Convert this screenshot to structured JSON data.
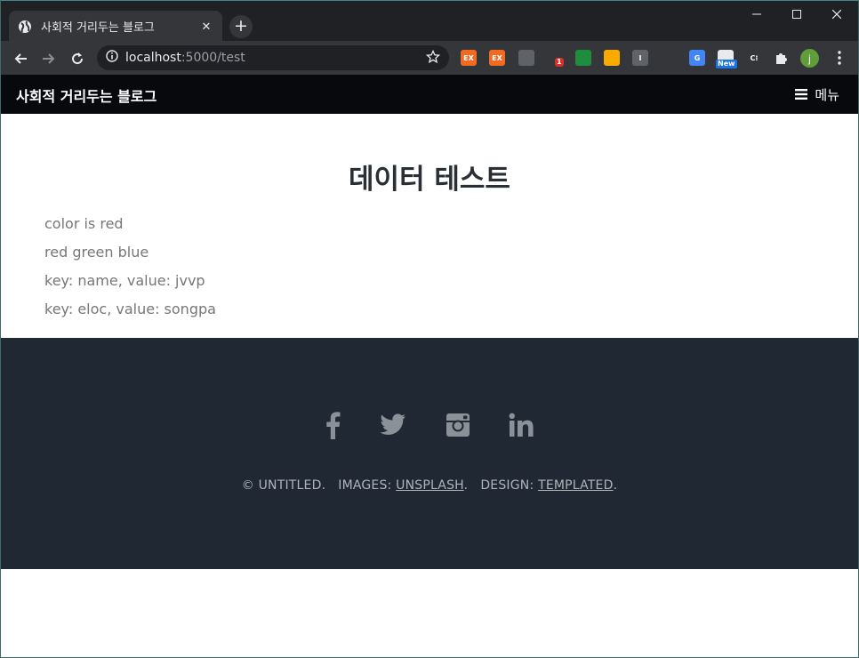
{
  "browser": {
    "tab_title": "사회적 거리두는 블로그",
    "tab_close": "✕",
    "new_tab": "+",
    "url_host": "localhost",
    "url_path": ":5000/test",
    "extensions": [
      {
        "name": "ex-extension-1",
        "label": "EX",
        "color": "#f06a24"
      },
      {
        "name": "ex-extension-2",
        "label": "EX",
        "color": "#f06a24"
      },
      {
        "name": "screenshot-extension",
        "label": "",
        "color": "#5f6368"
      },
      {
        "name": "badge-extension",
        "label": "",
        "badge": "1",
        "color": "#35363a"
      },
      {
        "name": "shield-extension",
        "label": "",
        "color": "#1e8e3e"
      },
      {
        "name": "glasses-extension",
        "label": "",
        "color": "#f9ab00"
      },
      {
        "name": "info-extension",
        "label": "I",
        "color": "#5f6368"
      },
      {
        "name": "cookie-extension",
        "label": "",
        "color": "#35363a"
      },
      {
        "name": "translate-extension",
        "label": "G",
        "color": "#4285f4"
      },
      {
        "name": "new-extension",
        "label": "",
        "badge": "New",
        "color": "#e8eaed"
      },
      {
        "name": "c-extension",
        "label": "C⁝",
        "color": "#35363a"
      }
    ],
    "avatar_letter": "j",
    "colors": {
      "titlebar": "#202124",
      "toolbar": "#35363a",
      "omnibox": "#202124"
    }
  },
  "site": {
    "logo": "사회적 거리두는 블로그",
    "menu_label": "메뉴"
  },
  "main": {
    "title": "데이터 테스트",
    "lines": [
      "color is red",
      "red green blue",
      "key: name, value: jvvp",
      "key: eloc, value: songpa"
    ]
  },
  "footer": {
    "social": [
      "facebook-icon",
      "twitter-icon",
      "instagram-icon",
      "linkedin-icon"
    ],
    "copyright": "© UNTITLED.",
    "images_label": "IMAGES:",
    "images_link": "UNSPLASH",
    "design_label": "DESIGN:",
    "design_link": "TEMPLATED",
    "period": "."
  }
}
